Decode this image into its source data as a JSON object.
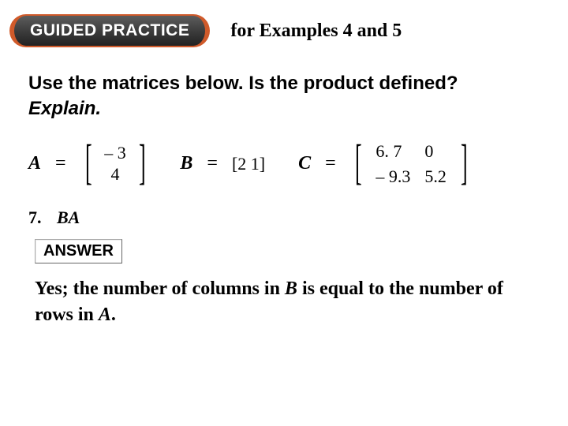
{
  "header": {
    "pill": "GUIDED PRACTICE",
    "subtitle": "for Examples 4 and 5"
  },
  "instruction": {
    "line1": "Use the matrices below. Is the product defined?",
    "explain": "Explain."
  },
  "matrices": {
    "A": {
      "label": "A",
      "eq": "=",
      "r1": "– 3",
      "r2": "4"
    },
    "B": {
      "label": "B",
      "eq": "=",
      "value": "[2  1]"
    },
    "C": {
      "label": "C",
      "eq": "=",
      "c11": "6. 7",
      "c12": "0",
      "c21": "– 9.3",
      "c22": "5.2"
    }
  },
  "question": {
    "number": "7.",
    "expr": "BA"
  },
  "answer": {
    "label": "ANSWER",
    "text_pre": "Yes; the number of columns in ",
    "b": "B",
    "text_mid": " is equal to the number of rows in ",
    "a": "A",
    "text_post": "."
  }
}
